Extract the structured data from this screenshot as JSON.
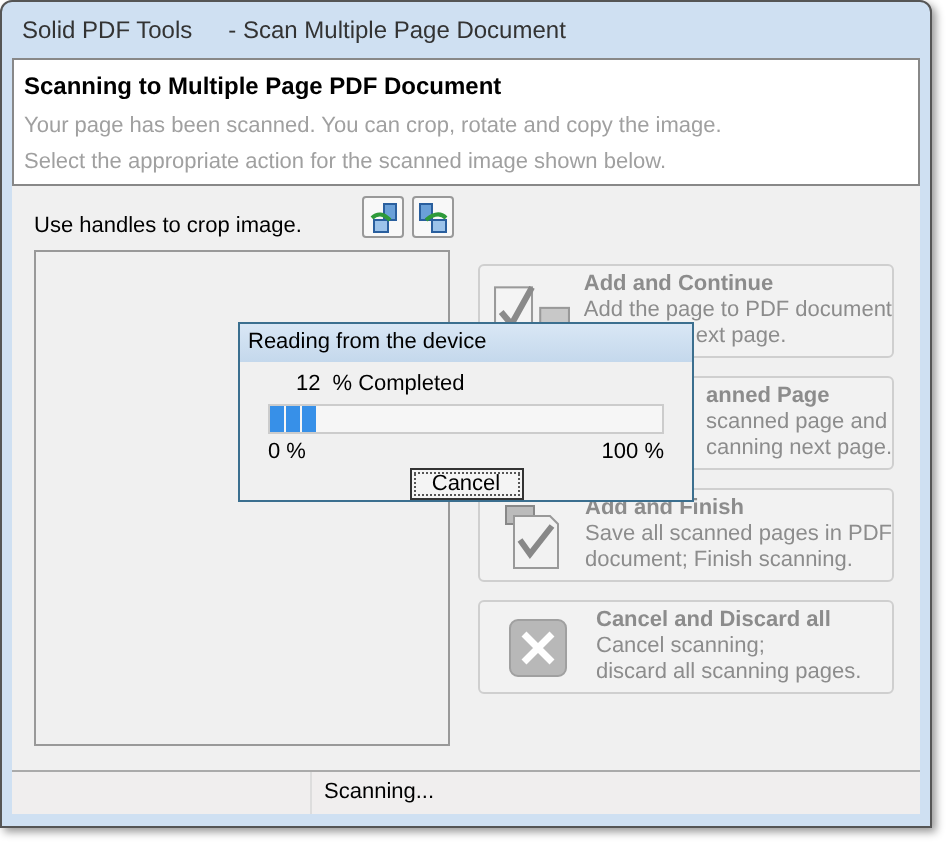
{
  "window": {
    "app_title": "Solid PDF Tools",
    "title": "- Scan Multiple Page Document"
  },
  "header": {
    "heading": "Scanning to Multiple Page PDF Document",
    "lines": [
      "Your page has been scanned. You can crop, rotate and copy the image.",
      "Select the appropriate action for the scanned image shown below."
    ]
  },
  "crop": {
    "label": "Use handles to crop image."
  },
  "actions": [
    {
      "kind": "continue",
      "title": "Add and Continue",
      "disabled": true,
      "lines": [
        {
          "kind": "full",
          "text": "Add the page to PDF document"
        },
        {
          "kind": "partial",
          "text": "ext page."
        }
      ]
    },
    {
      "kind": "covered",
      "title_partial": "anned Page",
      "disabled": true,
      "lines": [
        {
          "kind": "partial",
          "text": "scanned page and"
        },
        {
          "kind": "partial",
          "text": "canning next page."
        }
      ]
    },
    {
      "kind": "finish",
      "title": "Add and Finish",
      "disabled": true,
      "lines": [
        {
          "kind": "full",
          "text": "Save all scanned pages in PDF"
        },
        {
          "kind": "full",
          "text": "document; Finish scanning."
        }
      ]
    },
    {
      "kind": "discard",
      "title": "Cancel and Discard all",
      "disabled": true,
      "lines": [
        {
          "kind": "full",
          "text": "Cancel scanning;"
        },
        {
          "kind": "full",
          "text": "discard all scanning pages."
        }
      ]
    }
  ],
  "progress_dialog": {
    "title": "Reading from the device",
    "count": "12",
    "count_label": "% Completed",
    "level": 0.12,
    "min_label": "0 %",
    "max_label": "100 %",
    "button": "Cancel"
  },
  "status_bar": {
    "text": "Scanning..."
  }
}
